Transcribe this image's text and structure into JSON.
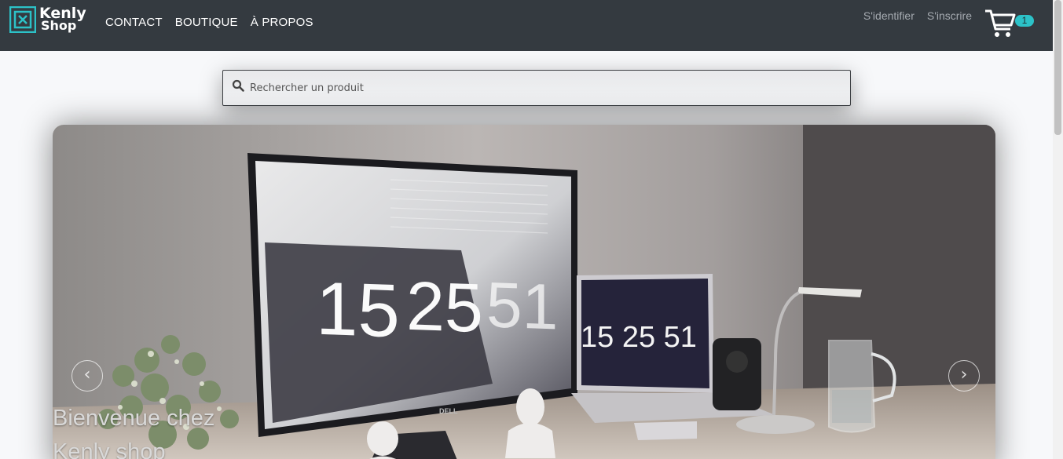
{
  "brand": {
    "line1": "Kenly",
    "line2": "Shop"
  },
  "nav": {
    "items": [
      "CONTACT",
      "BOUTIQUE",
      "À PROPOS"
    ]
  },
  "auth": {
    "login": "S'identifier",
    "register": "S'inscrire"
  },
  "cart": {
    "count": "1"
  },
  "search": {
    "placeholder": "Rechercher un produit"
  },
  "hero": {
    "caption_line1": "Bienvenue chez",
    "caption_line2": "Kenly shop",
    "monitor_clock": [
      "15",
      "25",
      "51"
    ],
    "laptop_clock": "15 25 51",
    "monitor_brand": "DELL",
    "prev_label": "‹",
    "next_label": "›"
  },
  "colors": {
    "navbar": "#343a40",
    "accent": "#2cc2c8",
    "page_bg": "#f7f8fa"
  }
}
